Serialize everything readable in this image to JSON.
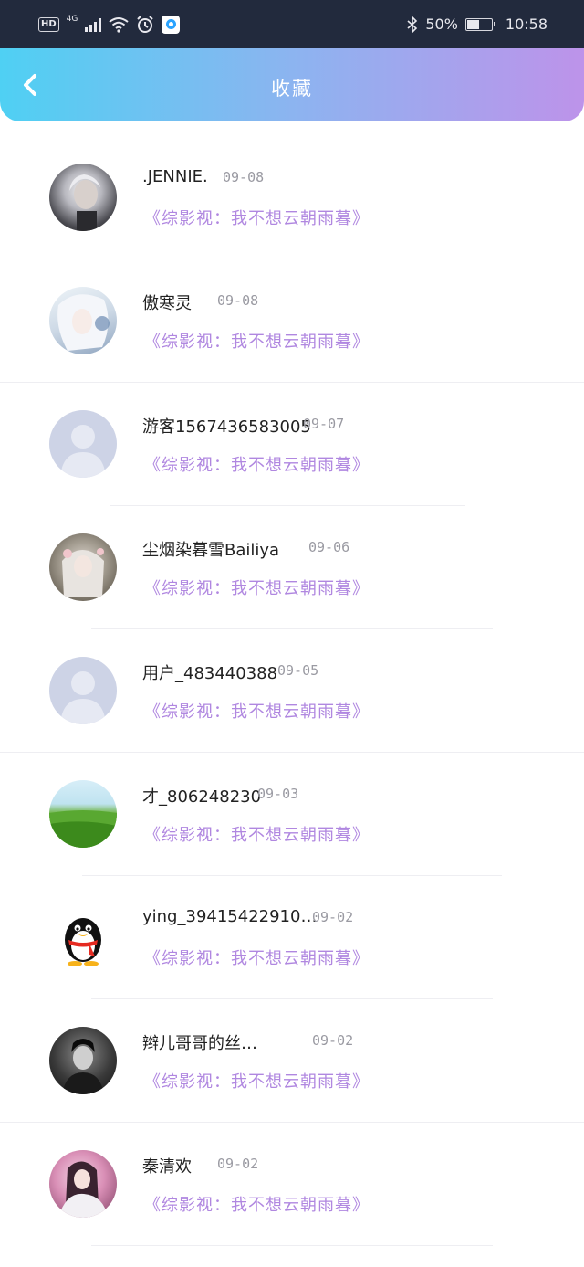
{
  "status_bar": {
    "hd": "HD",
    "network": "4G",
    "battery_pct": "50%",
    "time": "10:58",
    "icons": [
      "signal-icon",
      "wifi-icon",
      "alarm-icon",
      "app-icon",
      "bluetooth-icon",
      "battery-icon"
    ]
  },
  "header": {
    "title": "收藏",
    "back_icon": "chevron-left-icon"
  },
  "colors": {
    "header_gradient_start": "#4fd0f3",
    "header_gradient_end": "#bd93ea",
    "work_title": "#b087e0",
    "date": "#9a9aa2"
  },
  "items": [
    {
      "name": ".JENNIE.",
      "date": "09-08",
      "work": "《综影视：我不想云朝雨暮》",
      "avatar": "photo-man-silver-hair"
    },
    {
      "name": "傲寒灵",
      "date": "09-08",
      "work": "《综影视：我不想云朝雨暮》",
      "avatar": "anime-silver-hair"
    },
    {
      "name": "游客1567436583005",
      "date": "09-07",
      "work": "《综影视：我不想云朝雨暮》",
      "avatar": "default-user"
    },
    {
      "name": "尘烟染暮雪Bailiya",
      "date": "09-06",
      "work": "《综影视：我不想云朝雨暮》",
      "avatar": "anime-girl-flowers"
    },
    {
      "name": "用户_483440388",
      "date": "09-05",
      "work": "《综影视：我不想云朝雨暮》",
      "avatar": "default-user"
    },
    {
      "name": "才_806248230",
      "date": "09-03",
      "work": "《综影视：我不想云朝雨暮》",
      "avatar": "green-meadow"
    },
    {
      "name": "ying_39415422910…",
      "date": "09-02",
      "work": "《综影视：我不想云朝雨暮》",
      "avatar": "qq-penguin"
    },
    {
      "name": "辫儿哥哥的丝…",
      "date": "09-02",
      "work": "《综影视：我不想云朝雨暮》",
      "avatar": "bw-photo-man"
    },
    {
      "name": "秦清欢",
      "date": "09-02",
      "work": "《综影视：我不想云朝雨暮》",
      "avatar": "pink-photo-girl"
    }
  ]
}
